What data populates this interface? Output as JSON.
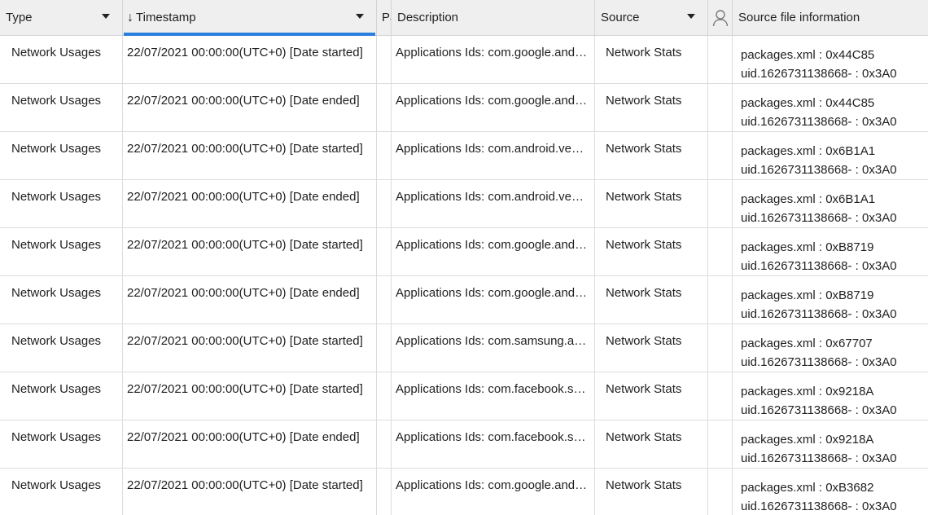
{
  "header": {
    "type": "Type",
    "timestamp": "Timestamp",
    "partial": "Pa",
    "description": "Description",
    "source": "Source",
    "source_file_information": "Source file information"
  },
  "rows": [
    {
      "type": "Network Usages",
      "timestamp": "22/07/2021 00:00:00(UTC+0) [Date started]",
      "description": "Applications Ids: com.google.andr...",
      "source": "Network Stats",
      "info1": "packages.xml : 0x44C85",
      "info2": "uid.1626731138668- : 0x3A0"
    },
    {
      "type": "Network Usages",
      "timestamp": "22/07/2021 00:00:00(UTC+0) [Date ended]",
      "description": "Applications Ids: com.google.andr...",
      "source": "Network Stats",
      "info1": "packages.xml : 0x44C85",
      "info2": "uid.1626731138668- : 0x3A0"
    },
    {
      "type": "Network Usages",
      "timestamp": "22/07/2021 00:00:00(UTC+0) [Date started]",
      "description": "Applications Ids: com.android.ven...",
      "source": "Network Stats",
      "info1": "packages.xml : 0x6B1A1",
      "info2": "uid.1626731138668- : 0x3A0"
    },
    {
      "type": "Network Usages",
      "timestamp": "22/07/2021 00:00:00(UTC+0) [Date ended]",
      "description": "Applications Ids: com.android.ven...",
      "source": "Network Stats",
      "info1": "packages.xml : 0x6B1A1",
      "info2": "uid.1626731138668- : 0x3A0"
    },
    {
      "type": "Network Usages",
      "timestamp": "22/07/2021 00:00:00(UTC+0) [Date started]",
      "description": "Applications Ids: com.google.andr...",
      "source": "Network Stats",
      "info1": "packages.xml : 0xB8719",
      "info2": "uid.1626731138668- : 0x3A0"
    },
    {
      "type": "Network Usages",
      "timestamp": "22/07/2021 00:00:00(UTC+0) [Date ended]",
      "description": "Applications Ids: com.google.andr...",
      "source": "Network Stats",
      "info1": "packages.xml : 0xB8719",
      "info2": "uid.1626731138668- : 0x3A0"
    },
    {
      "type": "Network Usages",
      "timestamp": "22/07/2021 00:00:00(UTC+0) [Date started]",
      "description": "Applications Ids: com.samsung.an...",
      "source": "Network Stats",
      "info1": "packages.xml : 0x67707",
      "info2": "uid.1626731138668- : 0x3A0"
    },
    {
      "type": "Network Usages",
      "timestamp": "22/07/2021 00:00:00(UTC+0) [Date started]",
      "description": "Applications Ids: com.facebook.ser...",
      "source": "Network Stats",
      "info1": "packages.xml : 0x9218A",
      "info2": "uid.1626731138668- : 0x3A0"
    },
    {
      "type": "Network Usages",
      "timestamp": "22/07/2021 00:00:00(UTC+0) [Date ended]",
      "description": "Applications Ids: com.facebook.ser...",
      "source": "Network Stats",
      "info1": "packages.xml : 0x9218A",
      "info2": "uid.1626731138668- : 0x3A0"
    },
    {
      "type": "Network Usages",
      "timestamp": "22/07/2021 00:00:00(UTC+0) [Date started]",
      "description": "Applications Ids: com.google.andr...",
      "source": "Network Stats",
      "info1": "packages.xml : 0xB3682",
      "info2": "uid.1626731138668- : 0x3A0"
    }
  ],
  "icons": {
    "sort": "sort-descending-icon",
    "dropdown": "chevron-down-icon",
    "user": "user-icon"
  },
  "colors": {
    "sort_accent": "#2b7fde",
    "header_bg": "#efefef"
  }
}
